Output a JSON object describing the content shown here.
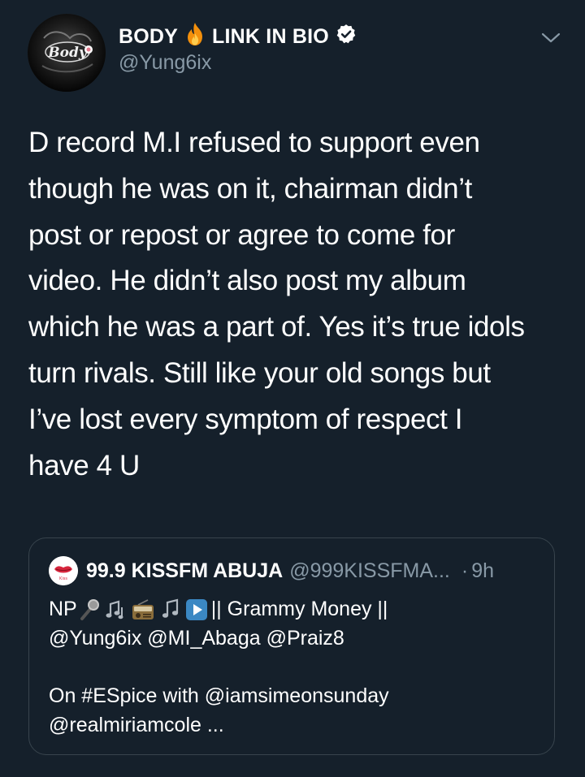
{
  "author": {
    "display_name_left": "BODY",
    "fire_emoji": "fire-emoji",
    "display_name_right": "LINK IN BIO",
    "verified_icon": "verified-badge-icon",
    "handle": "@Yung6ix",
    "avatar_logo_text": "Body"
  },
  "tweet": {
    "text": "D record M.I refused to support even\nthough he was on it, chairman didn’t\npost or repost or agree to come for\nvideo. He didn’t also post my album\nwhich he was a part of. Yes it’s true idols\nturn rivals. Still like your old songs but\nI’ve lost every symptom of respect I\nhave 4 U"
  },
  "quoted": {
    "avatar_text": "Kiss",
    "name": "99.9 KISSFM ABUJA",
    "handle": "@999KISSFMA...",
    "dot": "·",
    "time": "9h",
    "line1_prefix": "NP",
    "line1_emojis": [
      "microphone-emoji",
      "musical-notes-emoji",
      "radio-emoji",
      "music-note-emoji",
      "play-button-emoji"
    ],
    "line1_suffix": "|| Grammy Money ||",
    "line2": "@Yung6ix @MI_Abaga @Praiz8",
    "line3": "On #ESpice with @iamsimeonsunday",
    "line4": "@realmiriamcole  ..."
  },
  "colors": {
    "background": "#15202b",
    "text_primary": "#ffffff",
    "text_secondary": "#8899a6",
    "border": "#38444d"
  }
}
